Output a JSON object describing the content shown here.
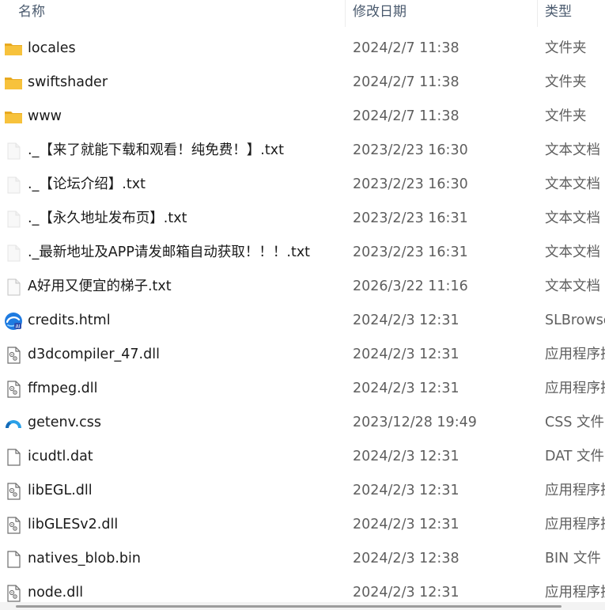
{
  "header": {
    "name_label": "名称",
    "date_label": "修改日期",
    "type_label": "类型"
  },
  "files": [
    {
      "name": "locales",
      "date": "2024/2/7 11:38",
      "type": "文件夹",
      "icon": "folder-icon"
    },
    {
      "name": "swiftshader",
      "date": "2024/2/7 11:38",
      "type": "文件夹",
      "icon": "folder-icon"
    },
    {
      "name": "www",
      "date": "2024/2/7 11:38",
      "type": "文件夹",
      "icon": "folder-icon"
    },
    {
      "name": "._【来了就能下载和观看！纯免费！】.txt",
      "date": "2023/2/23 16:30",
      "type": "文本文档",
      "icon": "hidden-text-file-icon"
    },
    {
      "name": "._【论坛介绍】.txt",
      "date": "2023/2/23 16:30",
      "type": "文本文档",
      "icon": "hidden-text-file-icon"
    },
    {
      "name": "._【永久地址发布页】.txt",
      "date": "2023/2/23 16:31",
      "type": "文本文档",
      "icon": "hidden-text-file-icon"
    },
    {
      "name": "._最新地址及APP请发邮箱自动获取！！！.txt",
      "date": "2023/2/23 16:31",
      "type": "文本文档",
      "icon": "hidden-text-file-icon"
    },
    {
      "name": "A好用又便宜的梯子.txt",
      "date": "2026/3/22 11:16",
      "type": "文本文档",
      "icon": "text-file-icon"
    },
    {
      "name": "credits.html",
      "date": "2024/2/3 12:31",
      "type": "SLBrowser",
      "icon": "browser-html-icon"
    },
    {
      "name": "d3dcompiler_47.dll",
      "date": "2024/2/3 12:31",
      "type": "应用程序扩展",
      "icon": "dll-file-icon"
    },
    {
      "name": "ffmpeg.dll",
      "date": "2024/2/3 12:31",
      "type": "应用程序扩展",
      "icon": "dll-file-icon"
    },
    {
      "name": "getenv.css",
      "date": "2023/12/28 19:49",
      "type": "CSS 文件",
      "icon": "css-file-icon"
    },
    {
      "name": "icudtl.dat",
      "date": "2024/2/3 12:31",
      "type": "DAT 文件",
      "icon": "blank-file-icon"
    },
    {
      "name": "libEGL.dll",
      "date": "2024/2/3 12:31",
      "type": "应用程序扩展",
      "icon": "dll-file-icon"
    },
    {
      "name": "libGLESv2.dll",
      "date": "2024/2/3 12:31",
      "type": "应用程序扩展",
      "icon": "dll-file-icon"
    },
    {
      "name": "natives_blob.bin",
      "date": "2024/2/3 12:38",
      "type": "BIN 文件",
      "icon": "blank-file-icon"
    },
    {
      "name": "node.dll",
      "date": "2024/2/3 12:31",
      "type": "应用程序扩展",
      "icon": "dll-file-icon"
    }
  ],
  "colors": {
    "folder": "#f7c23c",
    "folder_dark": "#e8a91f",
    "header_text": "#4a5a6e",
    "browser_blue": "#1f7be0",
    "css_blue": "#2aa0e8"
  }
}
